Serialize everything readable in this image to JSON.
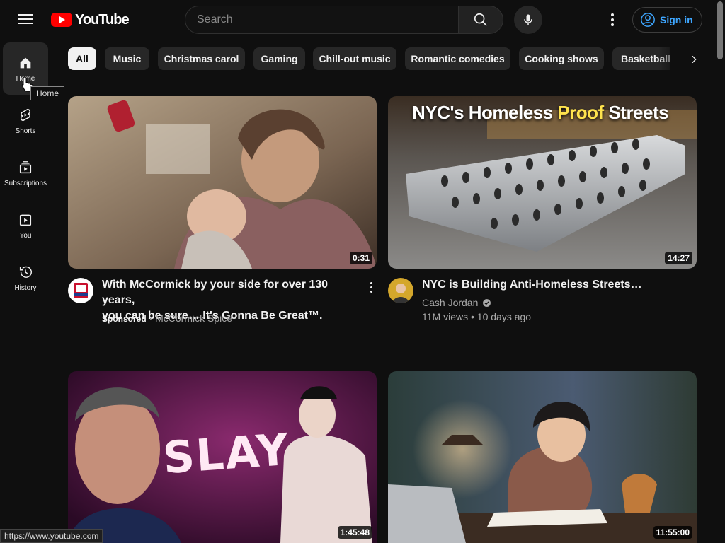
{
  "masthead": {
    "logo_text": "YouTube",
    "search_placeholder": "Search",
    "sign_in_label": "Sign in"
  },
  "sidebar": {
    "items": [
      {
        "label": "Home",
        "icon": "home-icon",
        "active": true
      },
      {
        "label": "Shorts",
        "icon": "shorts-icon"
      },
      {
        "label": "Subscriptions",
        "icon": "subscriptions-icon"
      },
      {
        "label": "You",
        "icon": "you-icon"
      },
      {
        "label": "History",
        "icon": "history-icon"
      }
    ],
    "tooltip": "Home"
  },
  "chips": [
    "All",
    "Music",
    "Christmas carol",
    "Gaming",
    "Chill-out music",
    "Romantic comedies",
    "Cooking shows",
    "Basketball"
  ],
  "videos": [
    {
      "title_line1": "With McCormick by your side for over 130 years,",
      "title_line2": "you can be sure… It's Gonna Be Great™.",
      "sponsored": "Sponsored",
      "channel": "McCormick Spice",
      "duration": "0:31"
    },
    {
      "thumb_headline_a": "NYC's Homeless ",
      "thumb_headline_b": "Proof",
      "thumb_headline_c": " Streets",
      "title": "NYC is Building Anti-Homeless Streets…",
      "channel": "Cash Jordan",
      "views": "11M views",
      "age": "10 days ago",
      "duration": "14:27"
    },
    {
      "thumb_text": "SLAY",
      "duration": "1:45:48"
    },
    {
      "duration": "11:55:00"
    }
  ],
  "status_url": "https://www.youtube.com",
  "colors": {
    "background": "#0f0f0f",
    "accent": "#ff0000",
    "link": "#3ea6ff"
  }
}
